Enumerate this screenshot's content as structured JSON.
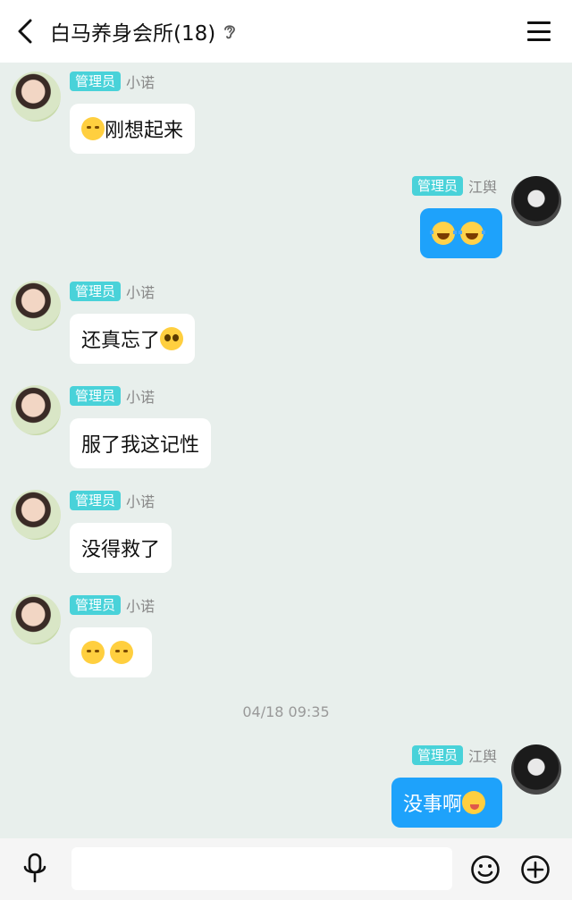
{
  "header": {
    "title": "白马养身会所(18)",
    "back_icon": "chevron-left-icon",
    "ear_icon": "ear-icon",
    "menu_icon": "hamburger-menu-icon"
  },
  "messages": [
    {
      "side": "in",
      "badge": "管理员",
      "name": "小诺",
      "text": "刚想起来",
      "emoji_before": [
        "blush"
      ]
    },
    {
      "side": "out",
      "badge": "管理员",
      "name": "江舆",
      "text": "",
      "emoji_after": [
        "laugh",
        "laugh"
      ]
    },
    {
      "side": "in",
      "badge": "管理员",
      "name": "小诺",
      "text": "还真忘了",
      "emoji_after": [
        "plead"
      ]
    },
    {
      "side": "in",
      "badge": "管理员",
      "name": "小诺",
      "text": "服了我这记性"
    },
    {
      "side": "in",
      "badge": "管理员",
      "name": "小诺",
      "text": "没得救了"
    },
    {
      "side": "in",
      "badge": "管理员",
      "name": "小诺",
      "text": "",
      "emoji_after": [
        "blush",
        "blush"
      ]
    },
    {
      "side": "out",
      "badge": "管理员",
      "name": "江舆",
      "text": "没事啊",
      "emoji_after": [
        "tease"
      ]
    }
  ],
  "timestamp": "04/18 09:35",
  "input": {
    "value": "",
    "placeholder": "",
    "mic_icon": "microphone-icon",
    "emoji_icon": "smiley-icon",
    "plus_icon": "plus-circle-icon"
  },
  "colors": {
    "background": "#e8efec",
    "badge": "#49d2d9",
    "outgoing_bubble": "#1ea2fb",
    "incoming_bubble": "#ffffff"
  }
}
